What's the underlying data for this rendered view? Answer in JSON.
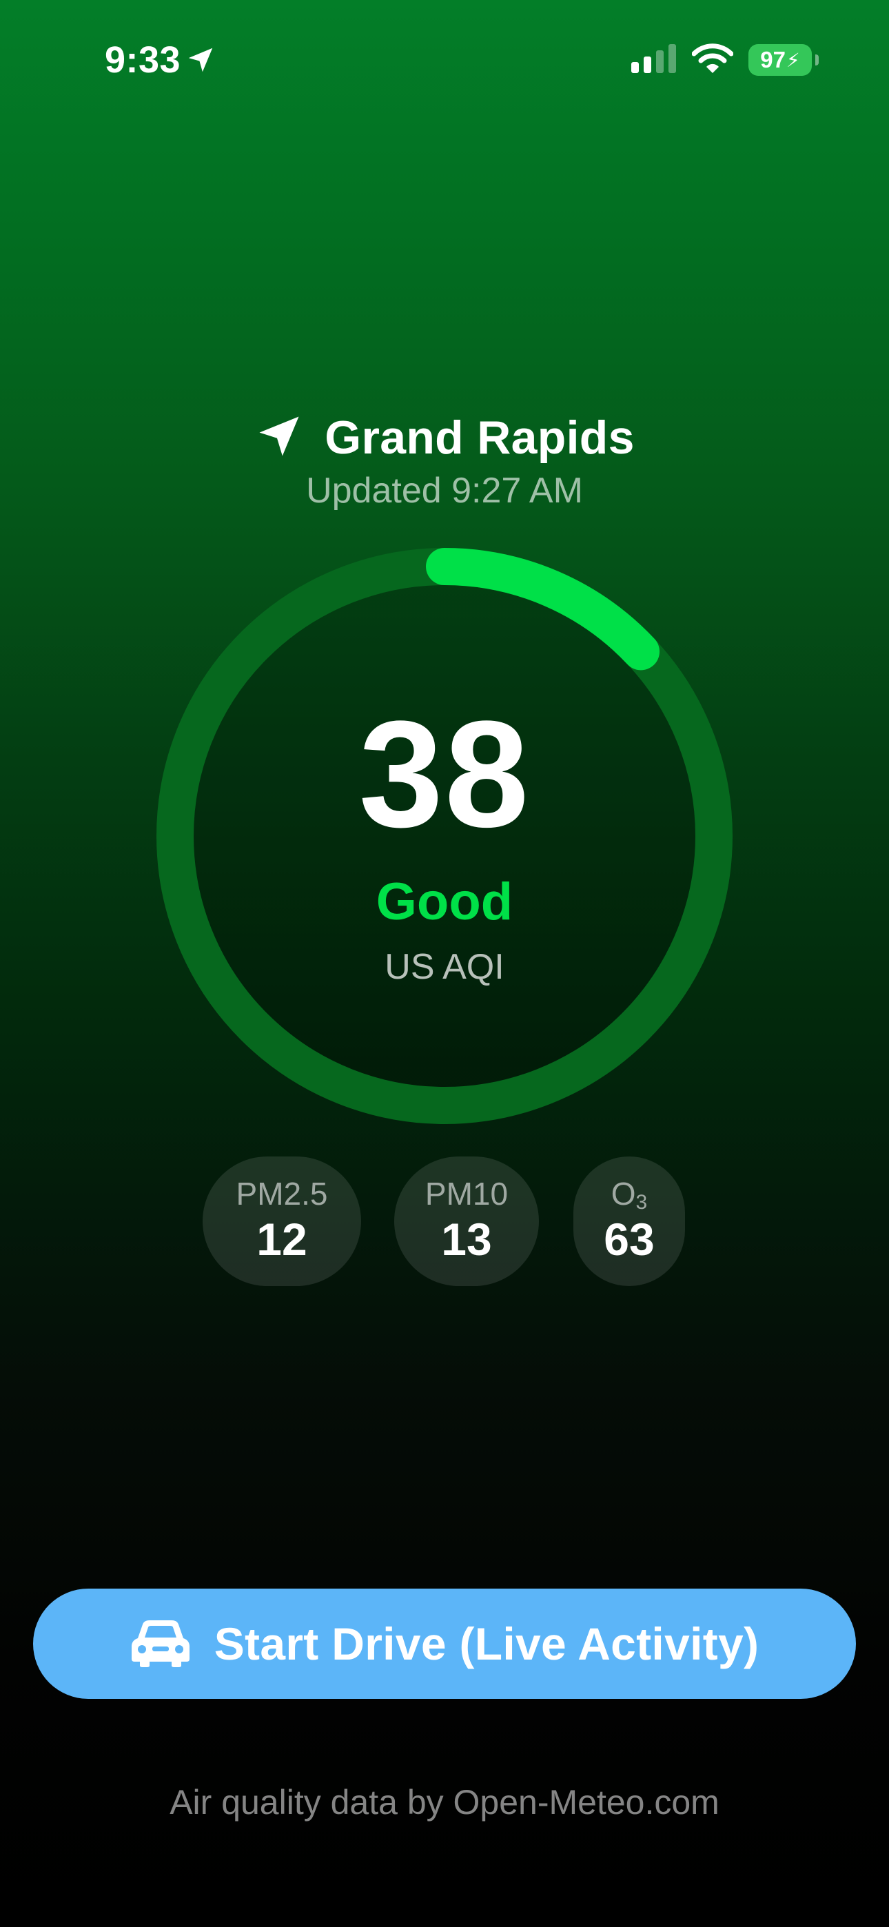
{
  "status_bar": {
    "time": "9:33",
    "location_icon": "location-arrow-icon",
    "signal_icon": "cellular-signal-icon",
    "wifi_icon": "wifi-icon",
    "battery_percent": "97",
    "battery_charging": true,
    "battery_color": "#34c759"
  },
  "location": {
    "icon": "location-arrow-icon",
    "city": "Grand Rapids",
    "updated": "Updated 9:27 AM"
  },
  "aqi": {
    "value": "38",
    "category": "Good",
    "scale": "US AQI",
    "ring_fill_fraction": 0.13,
    "category_color": "#00e048"
  },
  "pollutants": [
    {
      "label": "PM2.5",
      "value": "12"
    },
    {
      "label": "PM10",
      "value": "13"
    },
    {
      "label": "O",
      "subscript": "3",
      "value": "63"
    }
  ],
  "drive_button": {
    "icon": "car-icon",
    "label": "Start Drive (Live Activity)",
    "color": "#5cb5f8"
  },
  "attribution": "Air quality data by Open-Meteo.com"
}
